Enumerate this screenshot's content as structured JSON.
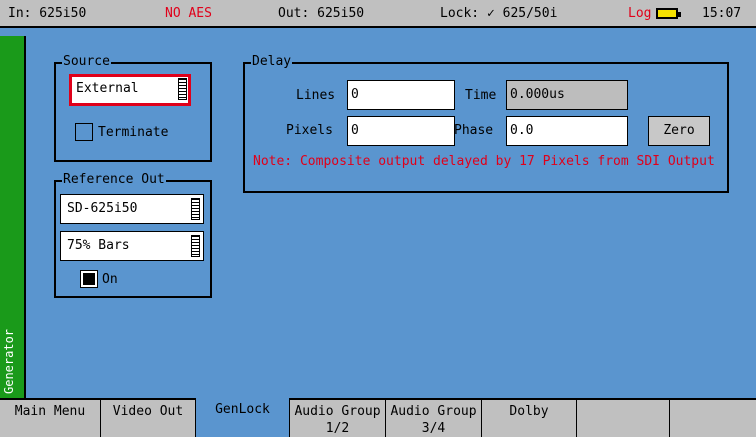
{
  "status": {
    "input": "In: 625i50",
    "aes": "NO AES",
    "output": "Out: 625i50",
    "lock": "Lock: ✓ 625/50i",
    "log": "Log",
    "battery_icon": "battery-icon",
    "clock": "15:07"
  },
  "side_label": "Generator",
  "source": {
    "title": "Source",
    "selection": "External",
    "terminate_label": "Terminate",
    "terminate_checked": false
  },
  "reference_out": {
    "title": "Reference Out",
    "format": "SD-625i50",
    "pattern": "75% Bars",
    "on_label": "On",
    "on_checked": true
  },
  "delay": {
    "title": "Delay",
    "lines_label": "Lines",
    "lines_value": "0",
    "time_label": "Time",
    "time_value": "0.000us",
    "pixels_label": "Pixels",
    "pixels_value": "0",
    "phase_label": "Phase",
    "phase_value": "0.0",
    "zero_button": "Zero",
    "note": "Note: Composite output delayed by 17 Pixels from SDI Output"
  },
  "tabs": [
    {
      "label": "Main Menu"
    },
    {
      "label": "Video Out"
    },
    {
      "label": "GenLock"
    },
    {
      "label": "Audio Group 1/2"
    },
    {
      "label": "Audio Group 3/4"
    },
    {
      "label": "Dolby"
    },
    {
      "label": ""
    },
    {
      "label": ""
    }
  ],
  "active_tab": "GenLock",
  "colors": {
    "background": "#5a95cf",
    "accent_red": "#e0001a",
    "side_green": "#1a9a1a",
    "chrome_gray": "#c0c0c0"
  }
}
